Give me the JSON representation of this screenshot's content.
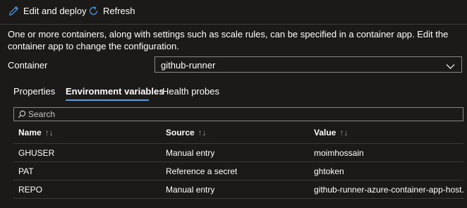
{
  "toolbar": {
    "edit_deploy_label": "Edit and deploy",
    "refresh_label": "Refresh"
  },
  "description": "One or more containers, along with settings such as scale rules, can be specified in a container app. Edit the container app to change the configuration.",
  "container": {
    "label": "Container",
    "selected": "github-runner"
  },
  "tabs": [
    {
      "label": "Properties",
      "active": false
    },
    {
      "label": "Environment variables",
      "active": true
    },
    {
      "label": "Health probes",
      "active": false
    }
  ],
  "search": {
    "placeholder": "Search"
  },
  "table": {
    "columns": [
      "Name",
      "Source",
      "Value"
    ],
    "sort_glyph": "↑↓",
    "rows": [
      {
        "name": "GHUSER",
        "source": "Manual entry",
        "value": "moimhossain"
      },
      {
        "name": "PAT",
        "source": "Reference a secret",
        "value": "ghtoken"
      },
      {
        "name": "REPO",
        "source": "Manual entry",
        "value": "github-runner-azure-container-app-host..."
      }
    ]
  },
  "colors": {
    "background": "#1b1a19",
    "accent": "#4f9ee8",
    "border": "#8a8886",
    "divider": "#3b3a39"
  }
}
